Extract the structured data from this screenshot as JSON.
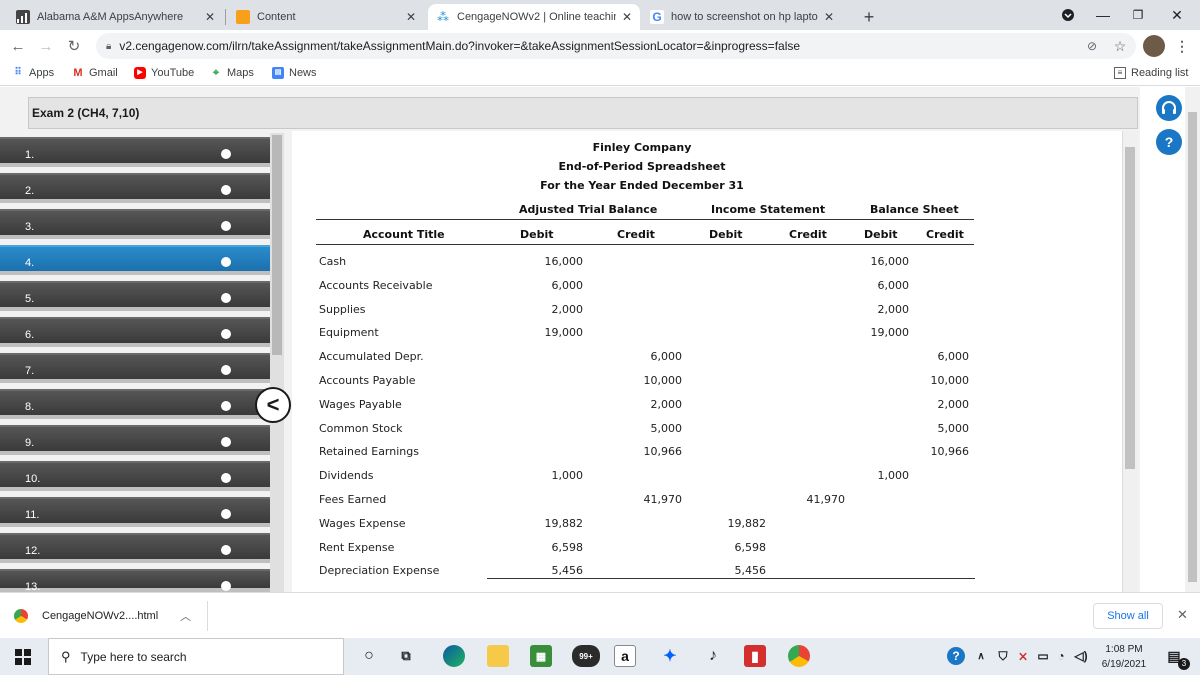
{
  "browser": {
    "tabs": [
      {
        "title": "Alabama A&M AppsAnywhere",
        "active": false
      },
      {
        "title": "Content",
        "active": false
      },
      {
        "title": "CengageNOWv2 | Online teachin",
        "active": true
      },
      {
        "title": "how to screenshot on hp laptop",
        "active": false
      }
    ],
    "new_tab": "+",
    "url": "v2.cengagenow.com/ilrn/takeAssignment/takeAssignmentMain.do?invoker=&takeAssignmentSessionLocator=&inprogress=false",
    "bookmarks": [
      {
        "label": "Apps",
        "icon": "apps-grid-icon"
      },
      {
        "label": "Gmail",
        "icon": "gmail-icon"
      },
      {
        "label": "YouTube",
        "icon": "youtube-icon"
      },
      {
        "label": "Maps",
        "icon": "maps-icon"
      },
      {
        "label": "News",
        "icon": "news-icon"
      }
    ],
    "reading_list": "Reading list"
  },
  "exam": {
    "title": "Exam 2 (CH4, 7,10)",
    "questions": [
      "1.",
      "2.",
      "3.",
      "4.",
      "5.",
      "6.",
      "7.",
      "8.",
      "9.",
      "10.",
      "11.",
      "12.",
      "13."
    ],
    "active_question": 4,
    "collapse_glyph": "<"
  },
  "spreadsheet": {
    "company": "Finley Company",
    "title": "End-of-Period Spreadsheet",
    "period": "For the Year Ended December 31",
    "group_headers": [
      "Adjusted Trial Balance",
      "Income Statement",
      "Balance Sheet"
    ],
    "col_headers": [
      "Account Title",
      "Debit",
      "Credit",
      "Debit",
      "Credit",
      "Debit",
      "Credit"
    ],
    "rows": [
      {
        "account": "Cash",
        "atb_dr": "16,000",
        "atb_cr": "",
        "is_dr": "",
        "is_cr": "",
        "bs_dr": "16,000",
        "bs_cr": ""
      },
      {
        "account": "Accounts Receivable",
        "atb_dr": "6,000",
        "atb_cr": "",
        "is_dr": "",
        "is_cr": "",
        "bs_dr": "6,000",
        "bs_cr": ""
      },
      {
        "account": "Supplies",
        "atb_dr": "2,000",
        "atb_cr": "",
        "is_dr": "",
        "is_cr": "",
        "bs_dr": "2,000",
        "bs_cr": ""
      },
      {
        "account": "Equipment",
        "atb_dr": "19,000",
        "atb_cr": "",
        "is_dr": "",
        "is_cr": "",
        "bs_dr": "19,000",
        "bs_cr": ""
      },
      {
        "account": "Accumulated Depr.",
        "atb_dr": "",
        "atb_cr": "6,000",
        "is_dr": "",
        "is_cr": "",
        "bs_dr": "",
        "bs_cr": "6,000"
      },
      {
        "account": "Accounts Payable",
        "atb_dr": "",
        "atb_cr": "10,000",
        "is_dr": "",
        "is_cr": "",
        "bs_dr": "",
        "bs_cr": "10,000"
      },
      {
        "account": "Wages Payable",
        "atb_dr": "",
        "atb_cr": "2,000",
        "is_dr": "",
        "is_cr": "",
        "bs_dr": "",
        "bs_cr": "2,000"
      },
      {
        "account": "Common Stock",
        "atb_dr": "",
        "atb_cr": "5,000",
        "is_dr": "",
        "is_cr": "",
        "bs_dr": "",
        "bs_cr": "5,000"
      },
      {
        "account": "Retained Earnings",
        "atb_dr": "",
        "atb_cr": "10,966",
        "is_dr": "",
        "is_cr": "",
        "bs_dr": "",
        "bs_cr": "10,966"
      },
      {
        "account": "Dividends",
        "atb_dr": "1,000",
        "atb_cr": "",
        "is_dr": "",
        "is_cr": "",
        "bs_dr": "1,000",
        "bs_cr": ""
      },
      {
        "account": "Fees Earned",
        "atb_dr": "",
        "atb_cr": "41,970",
        "is_dr": "",
        "is_cr": "41,970",
        "bs_dr": "",
        "bs_cr": ""
      },
      {
        "account": "Wages Expense",
        "atb_dr": "19,882",
        "atb_cr": "",
        "is_dr": "19,882",
        "is_cr": "",
        "bs_dr": "",
        "bs_cr": ""
      },
      {
        "account": "Rent Expense",
        "atb_dr": "6,598",
        "atb_cr": "",
        "is_dr": "6,598",
        "is_cr": "",
        "bs_dr": "",
        "bs_cr": ""
      },
      {
        "account": "Depreciation Expense",
        "atb_dr": "5,456",
        "atb_cr": "",
        "is_dr": "5,456",
        "is_cr": "",
        "bs_dr": "",
        "bs_cr": ""
      }
    ]
  },
  "downloads": {
    "file": "CengageNOWv2....html",
    "show_all": "Show all"
  },
  "taskbar": {
    "search_placeholder": "Type here to search",
    "badge": "99+",
    "time": "1:08 PM",
    "date": "6/19/2021",
    "notifications": "3"
  },
  "colors": {
    "nav_active": "#1c70ad",
    "nav_item": "#3a3a3a",
    "accent": "#1977c6"
  }
}
